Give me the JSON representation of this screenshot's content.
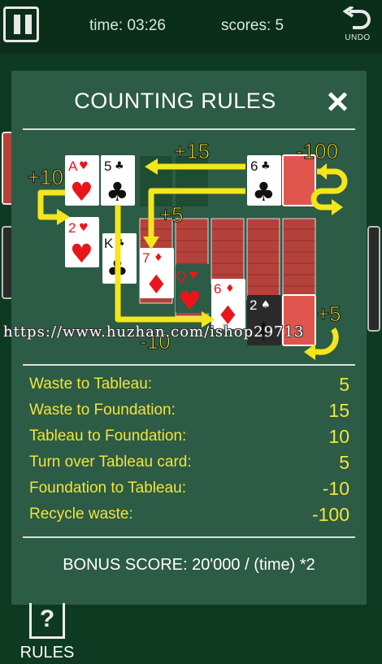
{
  "topbar": {
    "timer_text": "time: 03:26",
    "scores_text": "scores: 5",
    "undo_label": "UNDO"
  },
  "modal": {
    "title": "COUNTING RULES",
    "diagram_labels": {
      "plus15": "+15",
      "minus100": "-100",
      "plus10": "+10",
      "plus5_top": "+5",
      "minus10": "-10",
      "plus5_bottom": "+5"
    },
    "cards": {
      "ace_hearts": {
        "rank": "A",
        "suit": "♥"
      },
      "five_clubs": {
        "rank": "5",
        "suit": "♣"
      },
      "six_clubs": {
        "rank": "6",
        "suit": "♣"
      },
      "two_hearts": {
        "rank": "2",
        "suit": "♥"
      },
      "king_clubs": {
        "rank": "K",
        "suit": "♣"
      },
      "seven_diamonds": {
        "rank": "7",
        "suit": "♦"
      },
      "queen_hearts": {
        "rank": "Q",
        "suit": "♥"
      },
      "six_diamonds": {
        "rank": "6",
        "suit": "♦"
      },
      "two_spades": {
        "rank": "2",
        "suit": "♠"
      }
    },
    "rules": [
      {
        "label": "Waste to Tableau:",
        "value": "5"
      },
      {
        "label": "Waste to Foundation:",
        "value": "15"
      },
      {
        "label": "Tableau to Foundation:",
        "value": "10"
      },
      {
        "label": "Turn over Tableau card:",
        "value": "5"
      },
      {
        "label": "Foundation to Tableau:",
        "value": "-10"
      },
      {
        "label": "Recycle waste:",
        "value": "-100"
      }
    ],
    "bonus": "BONUS SCORE: 20'000 / (time) *2"
  },
  "watermark": "https://www.huzhan.com/ishop29713",
  "bottom": {
    "rules_icon": "?",
    "rules_label": "RULES"
  },
  "colors": {
    "background": "#0f3a22",
    "modal": "#2c5b46",
    "highlight_yellow": "#f2e43a",
    "arrow_yellow": "#f5e51b",
    "card_red": "#e8161b",
    "card_back": "#b5413b"
  },
  "icons": [
    "pause-icon",
    "undo-icon",
    "close-icon",
    "rules-icon"
  ]
}
